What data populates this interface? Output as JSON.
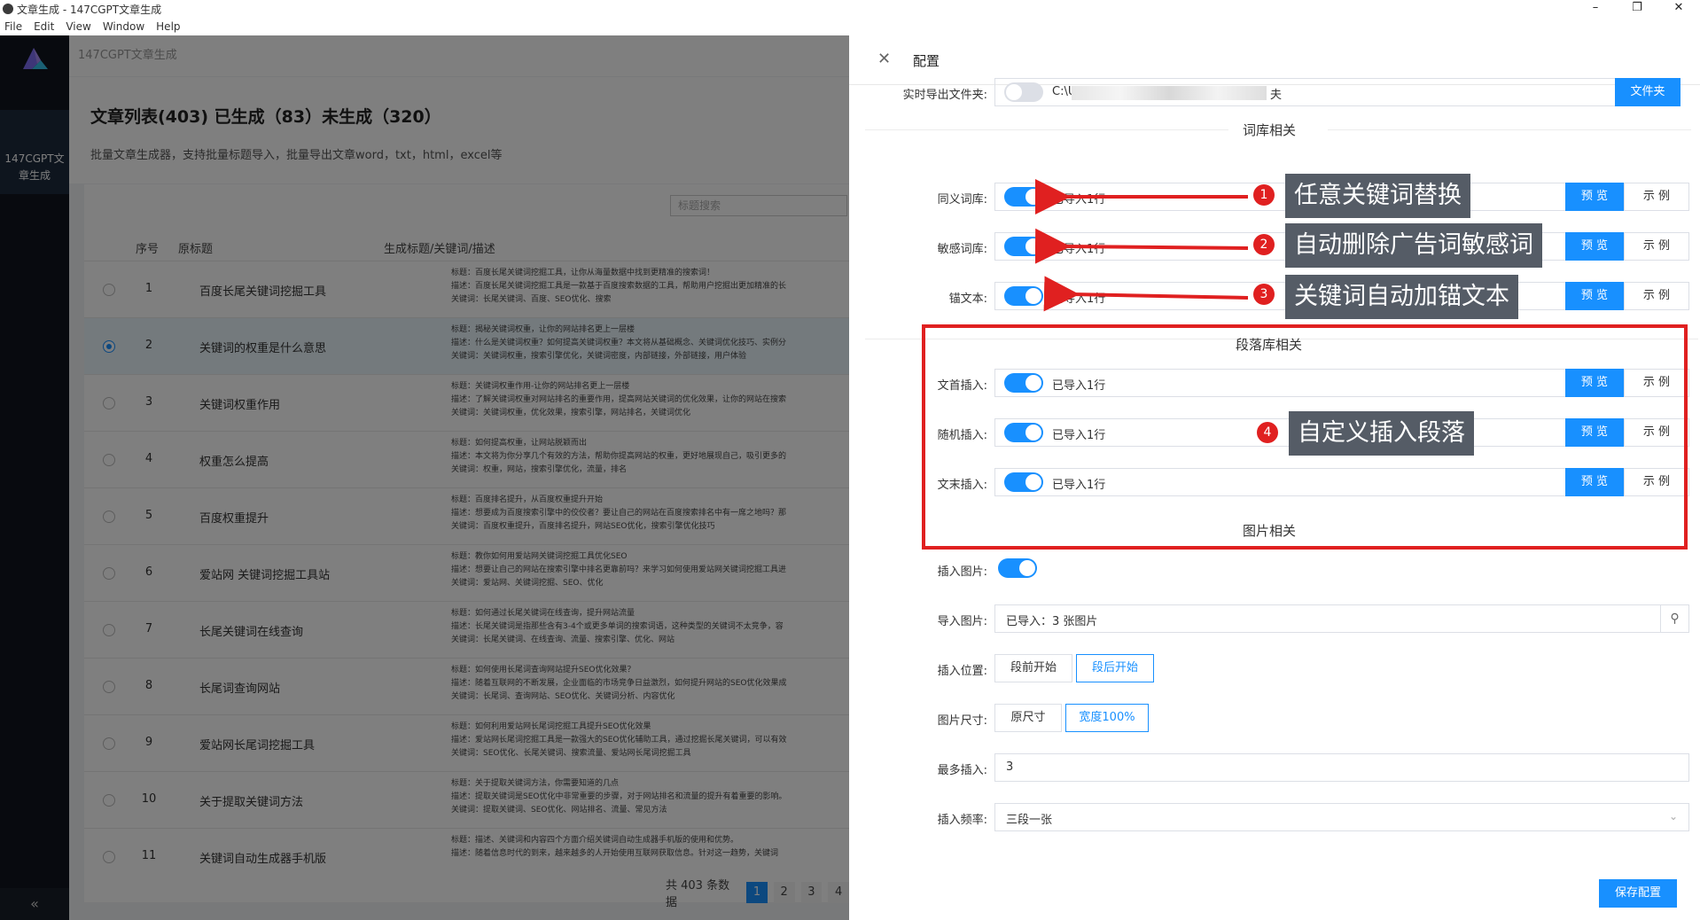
{
  "window": {
    "title": "文章生成 - 147CGPT文章生成",
    "minimize": "–",
    "maximize": "❐",
    "close": "✕"
  },
  "menu": [
    "File",
    "Edit",
    "View",
    "Window",
    "Help"
  ],
  "sidebar": {
    "item": "147CGPT文章生成",
    "collapse": "«"
  },
  "app": {
    "title": "147CGPT文章生成"
  },
  "header": {
    "title": "文章列表(403) 已生成（83）未生成（320）",
    "subtitle": "批量文章生成器，支持批量标题导入，批量导出文章word，txt，html，excel等"
  },
  "table": {
    "search_placeholder": "标题搜索",
    "columns": [
      "序号",
      "原标题",
      "生成标题/关键词/描述"
    ],
    "rows": [
      {
        "no": "1",
        "title": "百度长尾关键词挖掘工具",
        "desc": [
          "标题：百度长尾关键词挖掘工具，让你从海量数据中找到更精准的搜索词！",
          "描述：百度长尾关键词挖掘工具是一款基于百度搜索数据的工具，帮助用户挖掘出更加精准的长",
          "关键词：长尾关键词、百度、SEO优化、搜索"
        ]
      },
      {
        "no": "2",
        "title": "关键词的权重是什么意思",
        "desc": [
          "标题：揭秘关键词权重，让你的网站排名更上一层楼",
          "描述：什么是关键词权重？如何提高关键词权重？本文将从基础概念、关键词优化技巧、实例分",
          "关键词：关键词权重，搜索引擎优化，关键词密度，内部链接，外部链接，用户体验"
        ]
      },
      {
        "no": "3",
        "title": "关键词权重作用",
        "desc": [
          "标题：关键词权重作用-让你的网站排名更上一层楼",
          "描述：了解关键词权重对网站排名的重要作用，提高网站关键词的优化效果，让你的网站在搜索",
          "关键词：关键词权重，优化效果，搜索引擎，网站排名，关键词优化"
        ]
      },
      {
        "no": "4",
        "title": "权重怎么提高",
        "desc": [
          "标题：如何提高权重，让网站脱颖而出",
          "描述：本文将为你分享几个有效的方法，帮助你提高网站的权重，更好地展现自己，吸引更多的",
          "关键词：权重，网站，搜索引擎优化，流量，排名"
        ]
      },
      {
        "no": "5",
        "title": "百度权重提升",
        "desc": [
          "标题：百度排名提升，从百度权重提升开始",
          "描述：想要成为百度搜索引擎中的佼佼者？要让自己的网站在百度搜索排名中有一席之地吗？那",
          "关键词：百度权重提升，百度排名提升，网站SEO优化，搜索引擎优化技巧"
        ]
      },
      {
        "no": "6",
        "title": "爱站网 关键词挖掘工具站",
        "desc": [
          "标题：教你如何用爱站网关键词挖掘工具优化SEO",
          "描述：想要让自己的网站在搜索引擎中排名更靠前吗？来学习如何使用爱站网关键词挖掘工具进",
          "关键词：爱站网、关键词挖掘、SEO、优化"
        ]
      },
      {
        "no": "7",
        "title": "长尾关键词在线查询",
        "desc": [
          "标题：如何通过长尾关键词在线查询，提升网站流量",
          "描述：长尾关键词是指那些含有3-4个或更多单词的搜索词语，这种类型的关键词不太竞争，容",
          "关键词：长尾关键词、在线查询、流量、搜索引擎、优化、网站"
        ]
      },
      {
        "no": "8",
        "title": "长尾词查询网站",
        "desc": [
          "标题：如何使用长尾词查询网站提升SEO优化效果？",
          "描述：随着互联网的不断发展，企业面临的市场竞争日益激烈，如何提升网站的SEO优化效果成",
          "关键词：长尾词、查询网站、SEO优化、关键词分析、内容优化"
        ]
      },
      {
        "no": "9",
        "title": "爱站网长尾词挖掘工具",
        "desc": [
          "标题：如何利用爱站网长尾词挖掘工具提升SEO优化效果",
          "描述：爱站网长尾词挖掘工具是一款强大的SEO优化辅助工具，通过挖掘长尾关键词，可以有效",
          "关键词：SEO优化、长尾关键词、搜索流量、爱站网长尾词挖掘工具"
        ]
      },
      {
        "no": "10",
        "title": "关于提取关键词方法",
        "desc": [
          "标题：关于提取关键词方法，你需要知道的几点",
          "描述：提取关键词是SEO优化中非常重要的步骤，对于网站排名和流量的提升有着重要的影响。",
          "关键词：提取关键词、SEO优化、网站排名、流量、常见方法"
        ]
      },
      {
        "no": "11",
        "title": "关键词自动生成器手机版",
        "desc": [
          "标题：描述、关键词和内容四个方面介绍关键词自动生成器手机版的使用和优势。",
          "描述：随着信息时代的到来，越来越多的人开始使用互联网获取信息。针对这一趋势，关键词",
          ""
        ]
      }
    ],
    "selected_index": 1,
    "pager": {
      "total": "共 403 条数据",
      "pages": [
        "1",
        "2",
        "3",
        "4"
      ],
      "active": "1"
    }
  },
  "drawer": {
    "title": "配置",
    "close": "✕",
    "export": {
      "label": "实时导出文件夹:",
      "path_start": "C:\\U",
      "path_end": "夫",
      "button": "文件夹",
      "enabled": false
    },
    "section_lexicon": "词库相关",
    "lexicon_rows": [
      {
        "label": "同义词库:",
        "value": "已导入1行",
        "preview": "预 览",
        "example": "示 例"
      },
      {
        "label": "敏感词库:",
        "value": "已导入1行",
        "preview": "预 览",
        "example": "示 例"
      },
      {
        "label": "锚文本:",
        "value": "已导入1行",
        "preview": "预 览",
        "example": "示 例"
      }
    ],
    "section_paragraph": "段落库相关",
    "paragraph_rows": [
      {
        "label": "文首插入:",
        "value": "已导入1行",
        "preview": "预 览",
        "example": "示 例"
      },
      {
        "label": "随机插入:",
        "value": "已导入1行",
        "preview": "预 览",
        "example": "示 例"
      },
      {
        "label": "文末插入:",
        "value": "已导入1行",
        "preview": "预 览",
        "example": "示 例"
      }
    ],
    "section_image": "图片相关",
    "insert_image": {
      "label": "插入图片:",
      "enabled": true
    },
    "import_image": {
      "label": "导入图片:",
      "value": "已导入：3 张图片"
    },
    "insert_position": {
      "label": "插入位置:",
      "options": [
        "段前开始",
        "段后开始"
      ],
      "selected": "段后开始"
    },
    "image_size": {
      "label": "图片尺寸:",
      "options": [
        "原尺寸",
        "宽度100%"
      ],
      "selected": "宽度100%"
    },
    "max_insert": {
      "label": "最多插入:",
      "value": "3"
    },
    "frequency": {
      "label": "插入频率:",
      "value": "三段一张"
    },
    "save_button": "保存配置"
  },
  "annotations": [
    {
      "num": "1",
      "text": "任意关键词替换"
    },
    {
      "num": "2",
      "text": "自动删除广告词敏感词"
    },
    {
      "num": "3",
      "text": "关键词自动加锚文本"
    },
    {
      "num": "4",
      "text": "自定义插入段落"
    }
  ],
  "colors": {
    "accent": "#1890ff",
    "annotation_red": "#e02020",
    "sidebar": "#10151f",
    "callout_bg": "#555c66"
  }
}
